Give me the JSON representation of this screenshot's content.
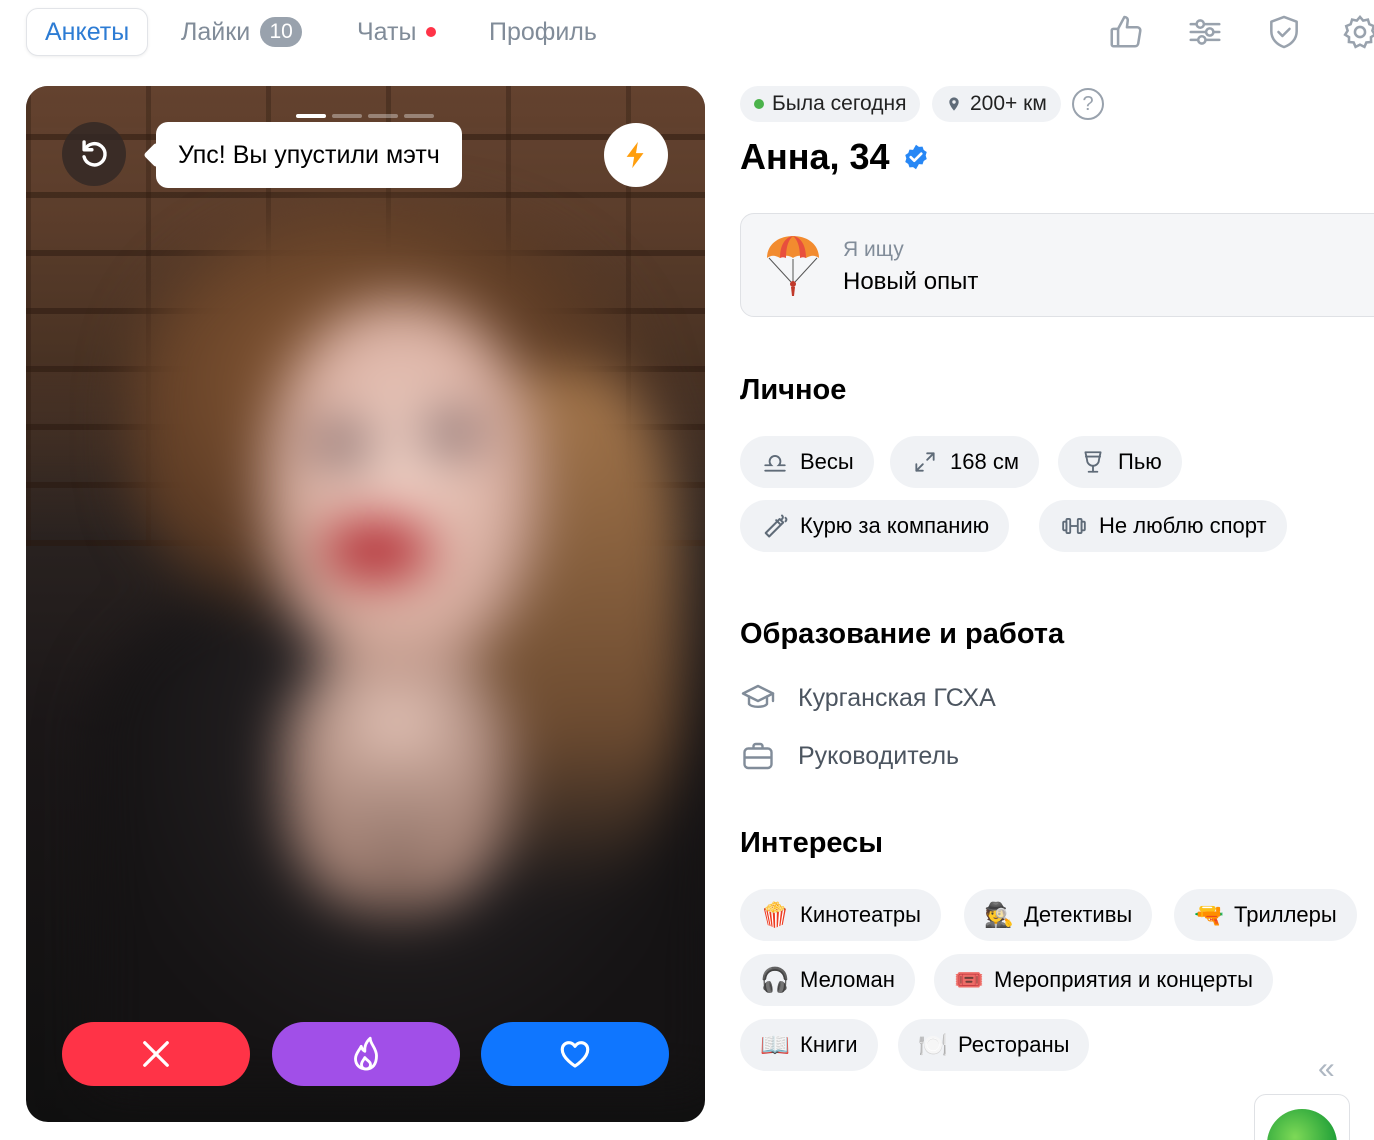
{
  "nav": {
    "tabs": [
      {
        "label": "Анкеты",
        "active": true
      },
      {
        "label": "Лайки",
        "badge": "10"
      },
      {
        "label": "Чаты",
        "has_dot": true
      },
      {
        "label": "Профиль"
      }
    ],
    "icons": [
      "thumbs-up-icon",
      "filters-icon",
      "shield-icon",
      "gear-icon"
    ]
  },
  "photo": {
    "tooltip": "Упс! Вы упустили мэтч",
    "indicator_count": 4,
    "active_indicator": 1,
    "actions": [
      "dislike",
      "super-like",
      "like"
    ]
  },
  "profile": {
    "status": "Была сегодня",
    "distance": "200+ км",
    "name": "Анна, 34",
    "verified": true,
    "looking_label": "Я ищу",
    "looking_value": "Новый опыт"
  },
  "personal": {
    "title": "Личное",
    "chips": [
      "Весы",
      "168 см",
      "Пью",
      "Курю за компанию",
      "Не люблю спорт"
    ]
  },
  "education": {
    "title": "Образование и работа",
    "school": "Курганская ГСХА",
    "job": "Руководитель"
  },
  "interests": {
    "title": "Интересы",
    "chips": [
      {
        "label": "Кинотеатры",
        "icon": "🍿"
      },
      {
        "label": "Детективы",
        "icon": "🕵️"
      },
      {
        "label": "Триллеры",
        "icon": "🔫"
      },
      {
        "label": "Меломан",
        "icon": "🎧"
      },
      {
        "label": "Мероприятия и концерты",
        "icon": "🎟️"
      },
      {
        "label": "Книги",
        "icon": "📖"
      },
      {
        "label": "Рестораны",
        "icon": "🍽️"
      }
    ]
  },
  "colors": {
    "accent": "#2d7cd4",
    "dislike": "#ff3347",
    "super": "#a14fe8",
    "like": "#0f76ff",
    "online": "#4bb34b"
  }
}
